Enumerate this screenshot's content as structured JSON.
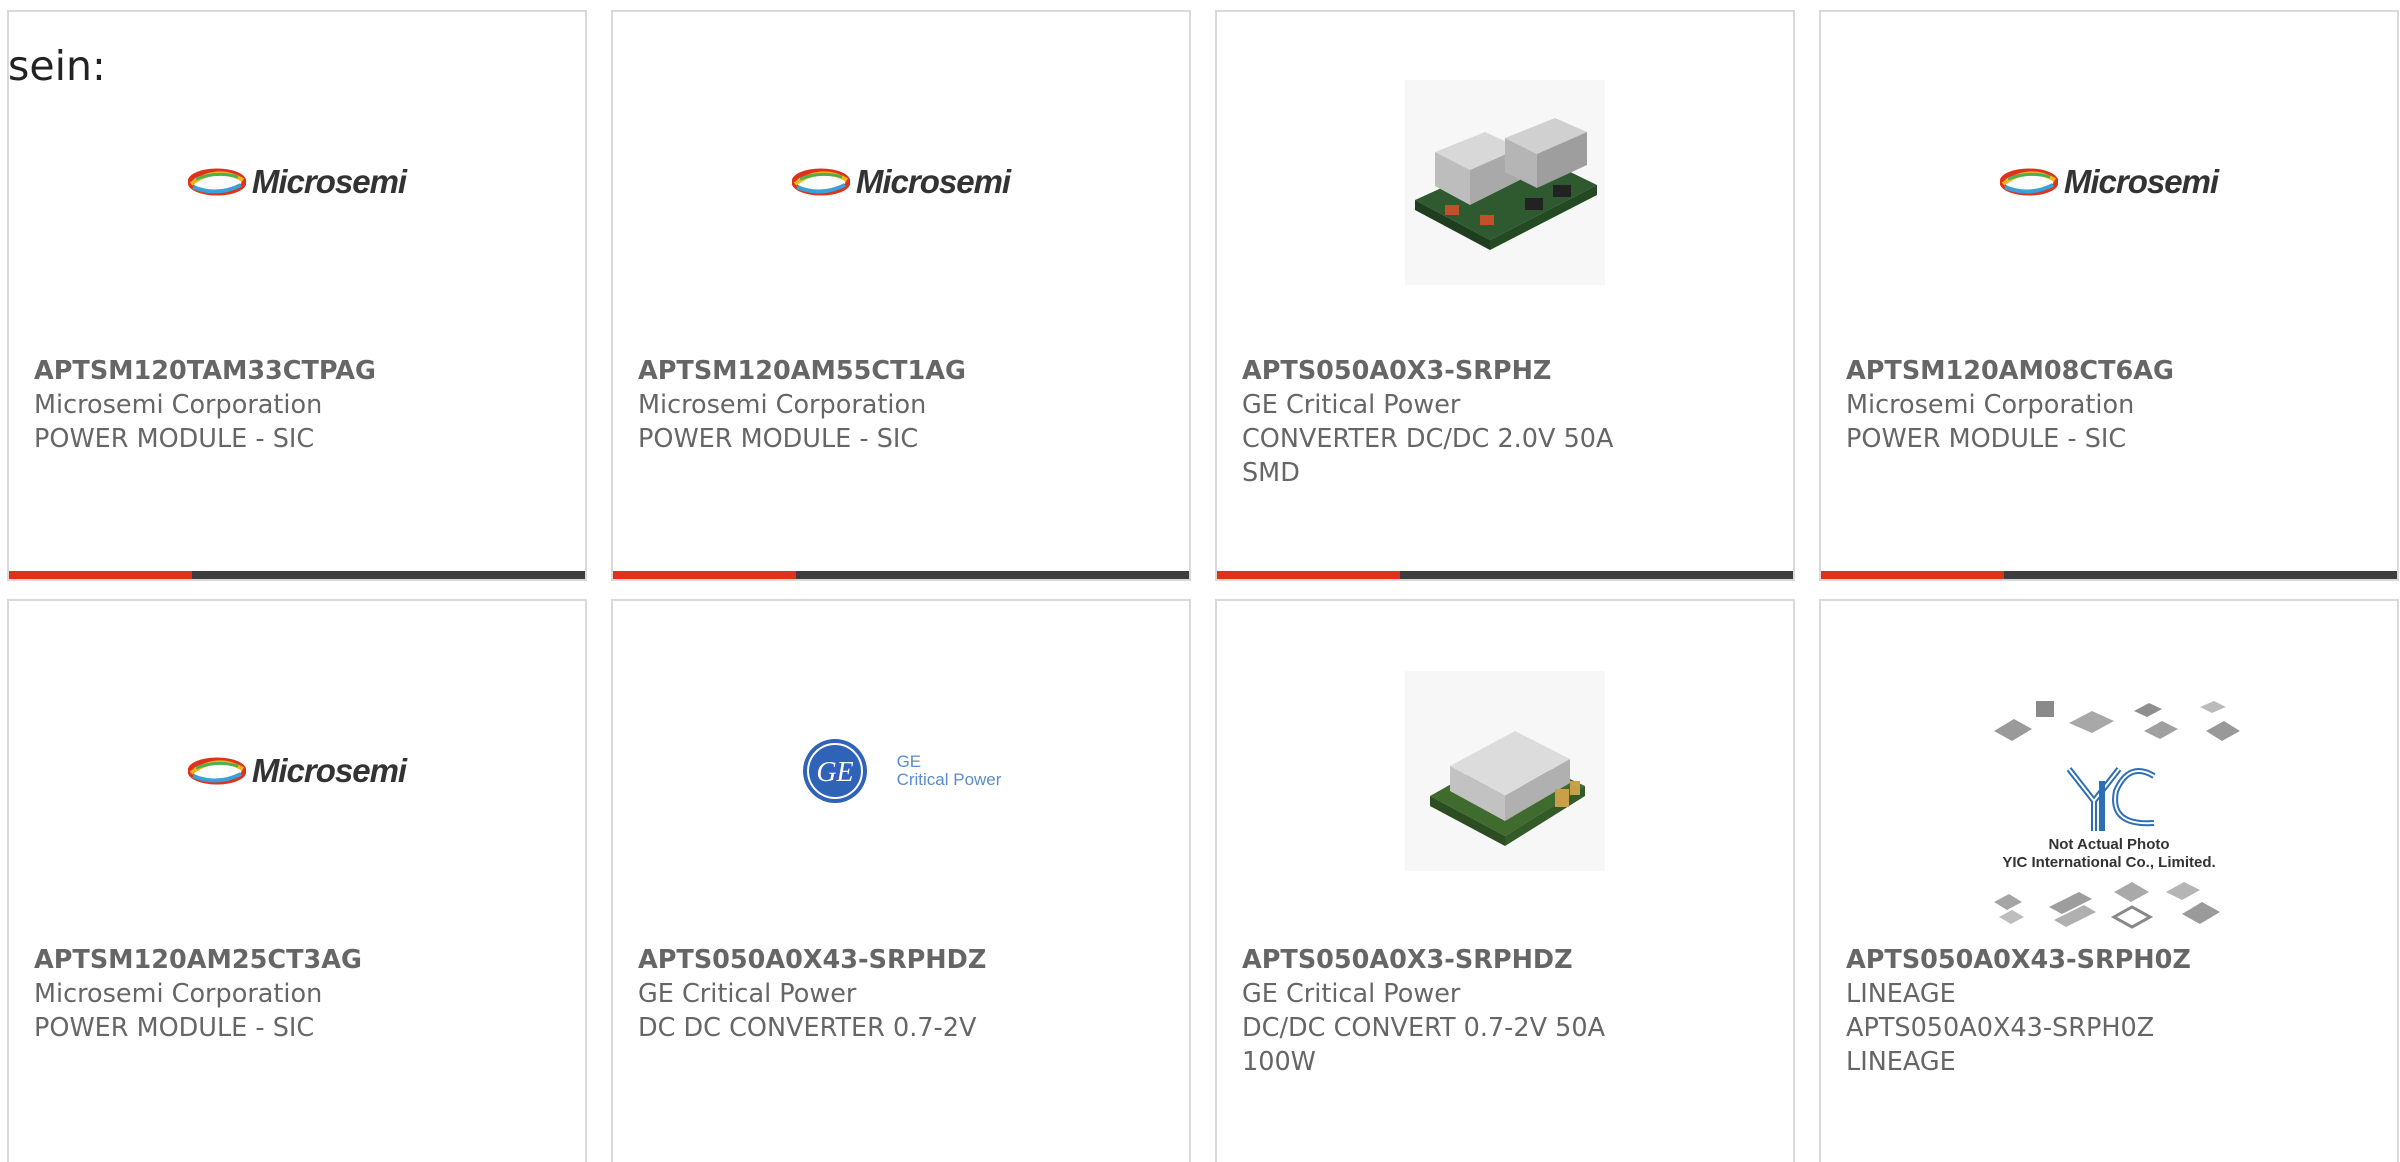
{
  "intro_text": "sein:",
  "accent_colors": {
    "bar_accent": "#e0311b",
    "bar_base": "#3d3d3d",
    "card_border": "#d9d9d9",
    "text": "#666666"
  },
  "products": [
    {
      "part_number": "APTSM120TAM33CTPAG",
      "manufacturer": "Microsemi Corporation",
      "description": "POWER MODULE - SIC",
      "image": "microsemi-logo",
      "logo_text": "Microsemi"
    },
    {
      "part_number": "APTSM120AM55CT1AG",
      "manufacturer": "Microsemi Corporation",
      "description": "POWER MODULE - SIC",
      "image": "microsemi-logo",
      "logo_text": "Microsemi"
    },
    {
      "part_number": "APTS050A0X3-SRPHZ",
      "manufacturer": "GE Critical Power",
      "description": "CONVERTER DC/DC 2.0V 50A SMD",
      "image": "converter-board-photo"
    },
    {
      "part_number": "APTSM120AM08CT6AG",
      "manufacturer": "Microsemi Corporation",
      "description": "POWER MODULE - SIC",
      "image": "microsemi-logo",
      "logo_text": "Microsemi"
    },
    {
      "part_number": "APTSM120AM25CT3AG",
      "manufacturer": "Microsemi Corporation",
      "description": "POWER MODULE - SIC",
      "image": "microsemi-logo",
      "logo_text": "Microsemi"
    },
    {
      "part_number": "APTS050A0X43-SRPHDZ",
      "manufacturer": "GE Critical Power",
      "description": "DC DC CONVERTER 0.7-2V",
      "image": "ge-critical-power-logo",
      "logo_text_line1": "GE",
      "logo_text_line2": "Critical Power"
    },
    {
      "part_number": "APTS050A0X3-SRPHDZ",
      "manufacturer": "GE Critical Power",
      "description": "DC/DC CONVERT 0.7-2V 50A 100W",
      "image": "module-photo"
    },
    {
      "part_number": "APTS050A0X43-SRPH0Z",
      "manufacturer": "LINEAGE",
      "description": "APTS050A0X43-SRPH0Z LINEAGE",
      "image": "yic-placeholder",
      "caption_line1": "Not Actual Photo",
      "caption_line2": "YIC International Co., Limited."
    }
  ]
}
